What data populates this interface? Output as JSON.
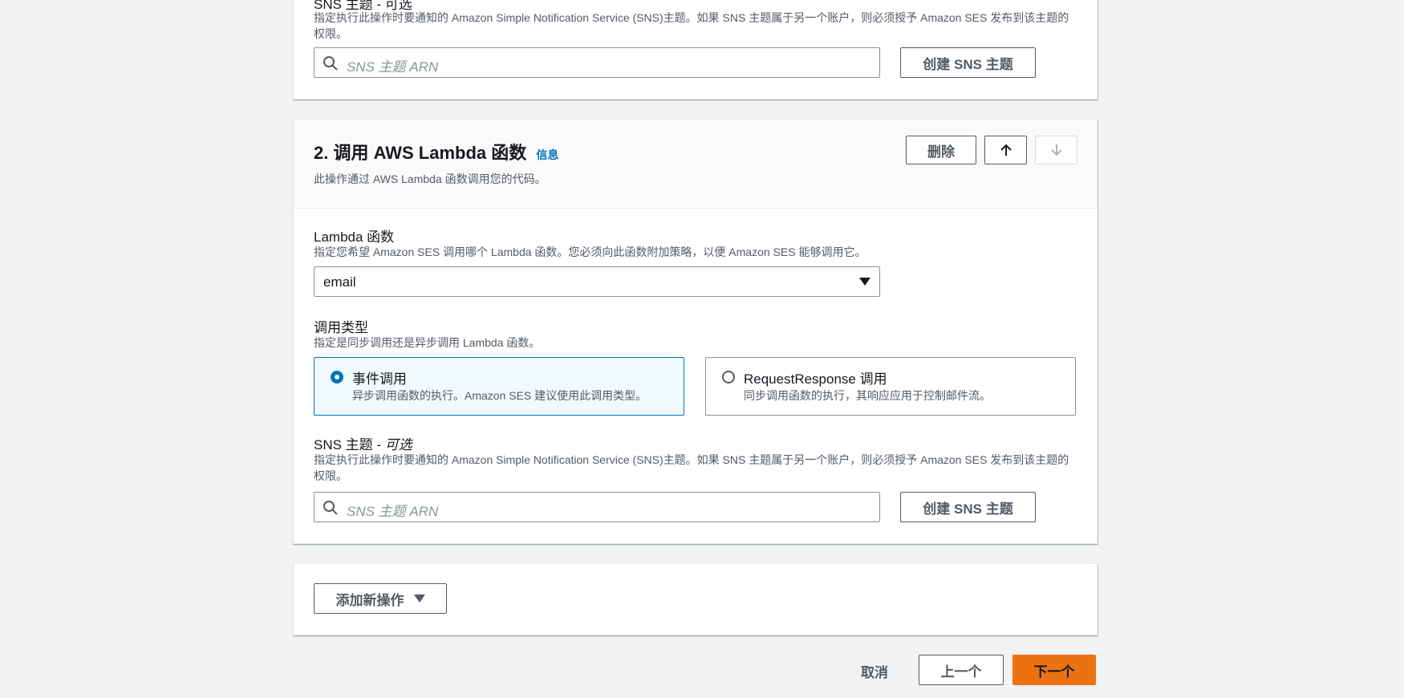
{
  "top_section": {
    "sns_label": "SNS 主题 - 可选",
    "sns_desc": "指定执行此操作时要通知的 Amazon Simple Notification Service (SNS)主题。如果 SNS 主题属于另一个账户，则必须授予 Amazon SES 发布到该主题的权限。",
    "sns_placeholder": "SNS 主题 ARN",
    "create_sns_label": "创建 SNS 主题"
  },
  "lambda_action": {
    "title": "2. 调用 AWS Lambda 函数",
    "info_link": "信息",
    "subtitle": "此操作通过 AWS Lambda 函数调用您的代码。",
    "delete_label": "删除",
    "function_label": "Lambda 函数",
    "function_desc": "指定您希望 Amazon SES 调用哪个 Lambda 函数。您必须向此函数附加策略，以便 Amazon SES 能够调用它。",
    "function_value": "email",
    "invocation_label": "调用类型",
    "invocation_desc": "指定是同步调用还是异步调用 Lambda 函数。",
    "options": [
      {
        "title": "事件调用",
        "desc": "异步调用函数的执行。Amazon SES 建议使用此调用类型。",
        "selected": true
      },
      {
        "title": "RequestResponse 调用",
        "desc": "同步调用函数的执行，其响应应用于控制邮件流。",
        "selected": false
      }
    ],
    "sns_label_main": "SNS 主题 - ",
    "sns_label_optional": "可选",
    "sns_desc": "指定执行此操作时要通知的 Amazon Simple Notification Service (SNS)主题。如果 SNS 主题属于另一个账户，则必须授予 Amazon SES 发布到该主题的权限。",
    "sns_placeholder": "SNS 主题 ARN",
    "create_sns_label": "创建 SNS 主题"
  },
  "add_action_label": "添加新操作",
  "footer": {
    "cancel": "取消",
    "previous": "上一个",
    "next": "下一个"
  },
  "colors": {
    "primary": "#ec7211",
    "link": "#0073bb",
    "selected_bg": "#f1faff"
  }
}
